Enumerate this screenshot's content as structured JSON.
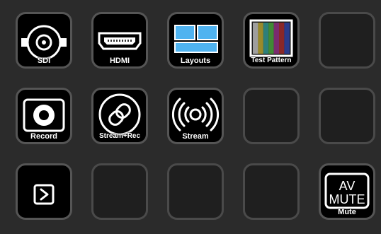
{
  "title": "",
  "keys": {
    "sdi": {
      "label": "SDI",
      "icon": "bnc-connector-icon"
    },
    "hdmi": {
      "label": "HDMI",
      "icon": "hdmi-port-icon"
    },
    "layouts": {
      "label": "Layouts",
      "icon": "layouts-grid-icon"
    },
    "test_pattern": {
      "label": "Test Pattern",
      "icon": "color-bars-icon"
    },
    "record": {
      "label": "Record",
      "icon": "record-icon"
    },
    "stream_rec": {
      "label": "Stream+Rec",
      "icon": "link-icon"
    },
    "stream": {
      "label": "Stream",
      "icon": "broadcast-icon"
    },
    "next_page": {
      "label": "",
      "icon": "chevron-right-icon"
    },
    "mute": {
      "label": "Mute",
      "icon_text_1": "AV",
      "icon_text_2": "MUTE"
    }
  },
  "colors": {
    "key_border": "#4a4a4a",
    "key_fill": "#1f1f1f",
    "active_fill": "#000000",
    "layout_blue": "#4fb3f0",
    "text": "#ffffff"
  }
}
